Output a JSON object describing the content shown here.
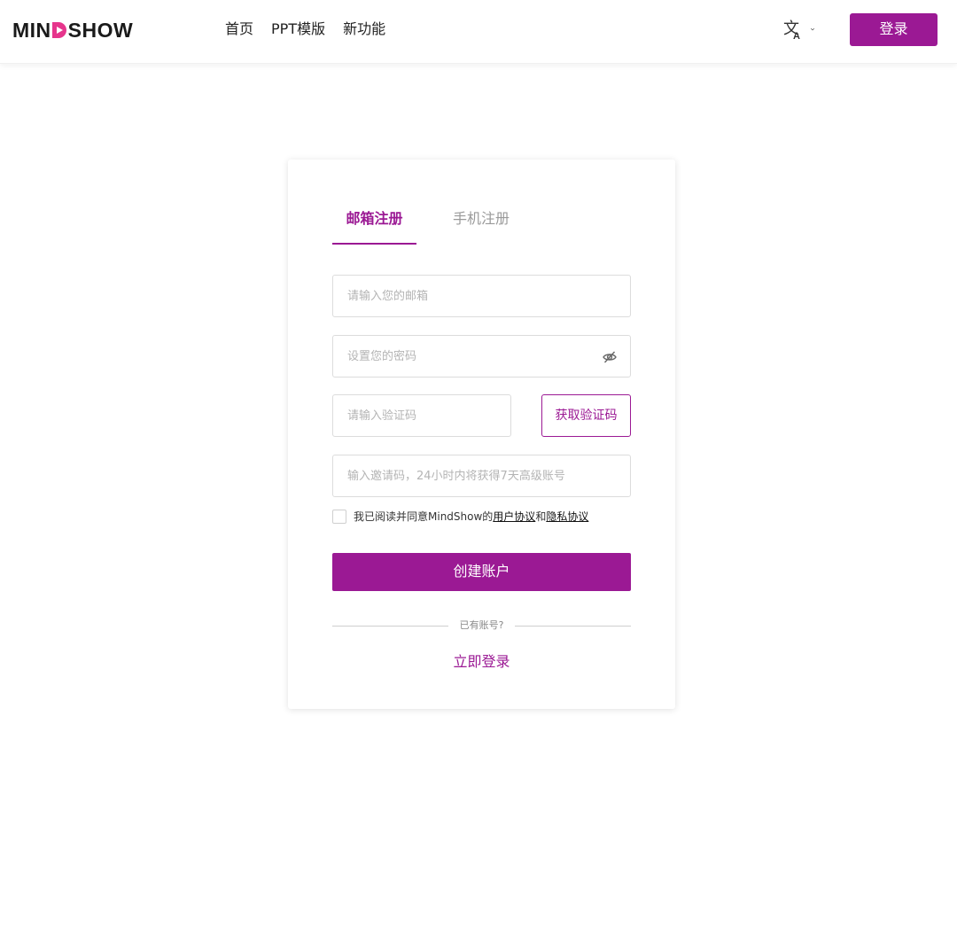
{
  "header": {
    "logo_prefix": "MIN",
    "logo_suffix": "SHOW",
    "nav": [
      {
        "label": "首页"
      },
      {
        "label": "PPT模版"
      },
      {
        "label": "新功能"
      }
    ],
    "language_icon": "translate-icon",
    "login_label": "登录"
  },
  "colors": {
    "brand": "#9b1994",
    "logo_accent": "#e6358c",
    "border": "#dcdcdc",
    "placeholder": "#b4b4b4"
  },
  "signup": {
    "tabs": [
      {
        "label": "邮箱注册",
        "active": true
      },
      {
        "label": "手机注册",
        "active": false
      }
    ],
    "email_placeholder": "请输入您的邮箱",
    "password_placeholder": "设置您的密码",
    "password_toggle_icon": "eye-off-icon",
    "code_placeholder": "请输入验证码",
    "get_code_label": "获取验证码",
    "invite_placeholder": "输入邀请码，24小时内将获得7天高级账号",
    "agree_prefix": "我已阅读并同意MindShow的",
    "user_agreement": "用户协议",
    "agree_and": "和",
    "privacy_agreement": "隐私协议",
    "agree_checked": false,
    "create_label": "创建账户",
    "has_account": "已有账号?",
    "login_now": "立即登录"
  }
}
